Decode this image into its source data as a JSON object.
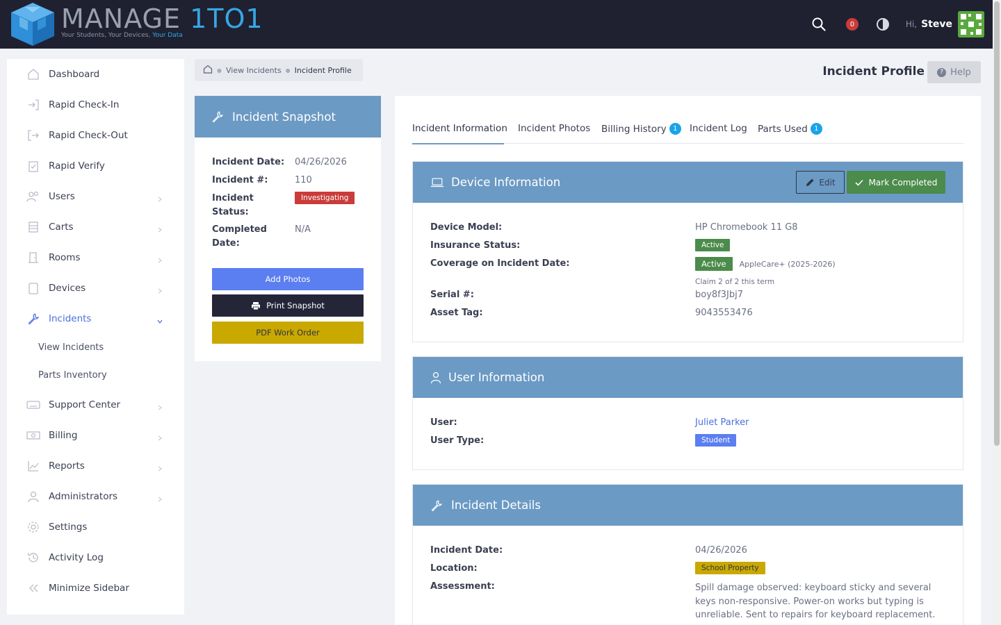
{
  "app": {
    "brand_main": "MANAGE ",
    "brand_accent": "1TO1",
    "tagline_main": "Your Students, Your Devices, ",
    "tagline_accent": "Your Data",
    "notification_count": "0",
    "greeting": "Hi,",
    "user_name": "Steve"
  },
  "sidebar": {
    "items": [
      {
        "label": "Dashboard",
        "icon": "home-icon"
      },
      {
        "label": "Rapid Check-In",
        "icon": "check-in-icon"
      },
      {
        "label": "Rapid Check-Out",
        "icon": "check-out-icon"
      },
      {
        "label": "Rapid Verify",
        "icon": "clipboard-check-icon"
      },
      {
        "label": "Users",
        "icon": "users-icon"
      },
      {
        "label": "Carts",
        "icon": "cart-icon"
      },
      {
        "label": "Rooms",
        "icon": "door-icon"
      },
      {
        "label": "Devices",
        "icon": "tablet-icon"
      },
      {
        "label": "Incidents",
        "icon": "wrench-icon"
      },
      {
        "label": "Support Center",
        "icon": "keyboard-icon"
      },
      {
        "label": "Billing",
        "icon": "money-icon"
      },
      {
        "label": "Reports",
        "icon": "chart-icon"
      },
      {
        "label": "Administrators",
        "icon": "admin-icon"
      },
      {
        "label": "Settings",
        "icon": "gear-icon"
      },
      {
        "label": "Activity Log",
        "icon": "history-icon"
      },
      {
        "label": "Minimize Sidebar",
        "icon": "double-chevron-left-icon"
      }
    ],
    "sub_items": [
      "View Incidents",
      "Parts Inventory"
    ]
  },
  "breadcrumb": {
    "link": "View Incidents",
    "current": "Incident Profile"
  },
  "page": {
    "title": "Incident Profile",
    "help_label": "Help"
  },
  "snapshot": {
    "title": "Incident Snapshot",
    "date_label": "Incident Date:",
    "date_value": "04/26/2026",
    "number_label": "Incident #:",
    "number_value": "110",
    "status_label": "Incident Status:",
    "status_value": "Investigating",
    "completed_label": "Completed Date:",
    "completed_value": "N/A",
    "add_photos": "Add Photos",
    "print_snapshot": "Print Snapshot",
    "pdf_work_order": "PDF Work Order"
  },
  "tabs": [
    {
      "label": "Incident Information"
    },
    {
      "label": "Incident Photos"
    },
    {
      "label": "Billing History",
      "count": "1"
    },
    {
      "label": "Incident Log"
    },
    {
      "label": "Parts Used",
      "count": "1"
    }
  ],
  "device": {
    "title": "Device Information",
    "edit_label": "Edit",
    "complete_label": "Mark Completed",
    "model_label": "Device Model:",
    "model_value": "HP Chromebook 11 G8",
    "insurance_label": "Insurance Status:",
    "insurance_value": "Active",
    "coverage_label": "Coverage on Incident Date:",
    "coverage_value": "Active",
    "coverage_plan": "AppleCare+ (2025-2026)",
    "claim_note": "Claim 2 of 2 this term",
    "serial_label": "Serial #:",
    "serial_value": "boy8f3Jbj7",
    "asset_label": "Asset Tag:",
    "asset_value": "9043553476"
  },
  "user": {
    "title": "User Information",
    "user_label": "User:",
    "user_value": "Juliet Parker",
    "type_label": "User Type:",
    "type_value": "Student"
  },
  "details": {
    "title": "Incident Details",
    "date_label": "Incident Date:",
    "date_value": "04/26/2026",
    "location_label": "Location:",
    "location_value": "School Property",
    "assessment_label": "Assessment:",
    "assessment_value": "Spill damage observed: keyboard sticky and several keys non-responsive. Power-on works but typing is unreliable. Sent to repairs for keyboard replacement."
  },
  "colors": {
    "header_bg": "#1f2131",
    "card_header": "#6b9ac4",
    "primary": "#5b7ef0",
    "danger": "#c93c3a",
    "success": "#4b8b4b",
    "warning": "#c9a800",
    "info": "#1aa3e8"
  }
}
